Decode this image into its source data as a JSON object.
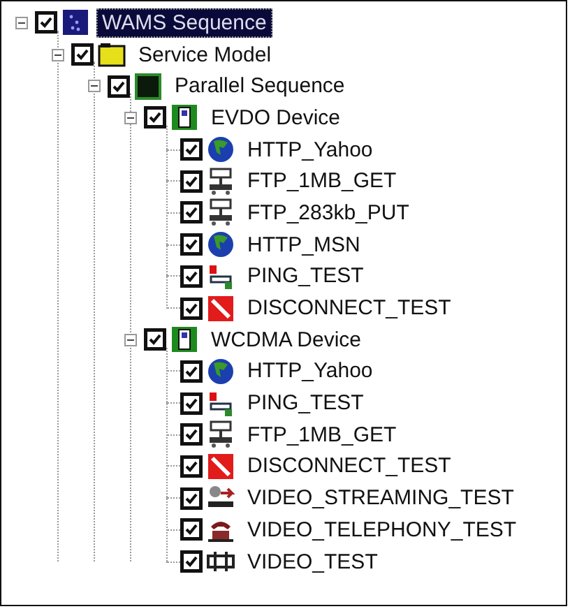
{
  "tree": [
    {
      "label": "WAMS Sequence",
      "kind": "sequence",
      "checked": true,
      "expanded": true,
      "selected": true,
      "children": [
        {
          "label": "Service Model",
          "kind": "model",
          "checked": true,
          "expanded": true,
          "selected": false,
          "children": [
            {
              "label": "Parallel Sequence",
              "kind": "parallel",
              "checked": true,
              "expanded": true,
              "selected": false,
              "children": [
                {
                  "label": "EVDO Device",
                  "kind": "device",
                  "checked": true,
                  "expanded": true,
                  "selected": false,
                  "children": [
                    {
                      "label": "HTTP_Yahoo",
                      "kind": "http",
                      "checked": true,
                      "selected": false
                    },
                    {
                      "label": "FTP_1MB_GET",
                      "kind": "ftp",
                      "checked": true,
                      "selected": false
                    },
                    {
                      "label": "FTP_283kb_PUT",
                      "kind": "ftp",
                      "checked": true,
                      "selected": false
                    },
                    {
                      "label": "HTTP_MSN",
                      "kind": "http",
                      "checked": true,
                      "selected": false
                    },
                    {
                      "label": "PING_TEST",
                      "kind": "ping",
                      "checked": true,
                      "selected": false
                    },
                    {
                      "label": "DISCONNECT_TEST",
                      "kind": "disconnect",
                      "checked": true,
                      "selected": false
                    }
                  ]
                },
                {
                  "label": "WCDMA Device",
                  "kind": "device",
                  "checked": true,
                  "expanded": true,
                  "selected": false,
                  "children": [
                    {
                      "label": "HTTP_Yahoo",
                      "kind": "http",
                      "checked": true,
                      "selected": false
                    },
                    {
                      "label": "PING_TEST",
                      "kind": "ping",
                      "checked": true,
                      "selected": false
                    },
                    {
                      "label": "FTP_1MB_GET",
                      "kind": "ftp",
                      "checked": true,
                      "selected": false
                    },
                    {
                      "label": "DISCONNECT_TEST",
                      "kind": "disconnect",
                      "checked": true,
                      "selected": false
                    },
                    {
                      "label": "VIDEO_STREAMING_TEST",
                      "kind": "streaming",
                      "checked": true,
                      "selected": false
                    },
                    {
                      "label": "VIDEO_TELEPHONY_TEST",
                      "kind": "telephony",
                      "checked": true,
                      "selected": false
                    },
                    {
                      "label": "VIDEO_TEST",
                      "kind": "video",
                      "checked": true,
                      "selected": false
                    }
                  ]
                }
              ]
            }
          ]
        }
      ]
    }
  ]
}
